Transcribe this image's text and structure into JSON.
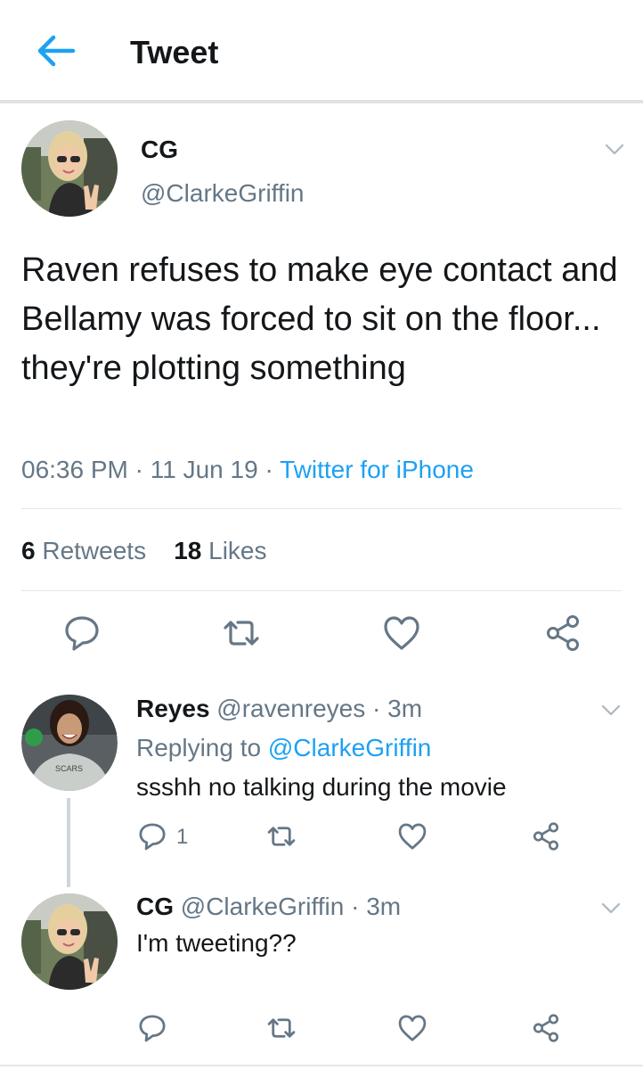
{
  "header": {
    "title": "Tweet",
    "back_icon": "arrow-left-icon",
    "accent": "#1da1f2"
  },
  "tweet": {
    "name": "CG",
    "handle": "@ClarkeGriffin",
    "text": "Raven refuses to make eye contact and Bellamy was forced to sit on the floor... they're plotting something",
    "time": "06:36 PM",
    "date": "11 Jun 19",
    "source": "Twitter for iPhone",
    "separator": "·",
    "retweets_count": "6",
    "retweets_label": "Retweets",
    "likes_count": "18",
    "likes_label": "Likes",
    "actions": [
      "reply-icon",
      "retweet-icon",
      "like-icon",
      "share-icon"
    ]
  },
  "replies": [
    {
      "name": "Reyes",
      "handle": "@ravenreyes",
      "time": "3m",
      "replying_prefix": "Replying to",
      "replying_to": "@ClarkeGriffin",
      "text": "ssshh no talking during the movie",
      "reply_count": "1"
    },
    {
      "name": "CG",
      "handle": "@ClarkeGriffin",
      "time": "3m",
      "text": "I'm tweeting??"
    }
  ]
}
